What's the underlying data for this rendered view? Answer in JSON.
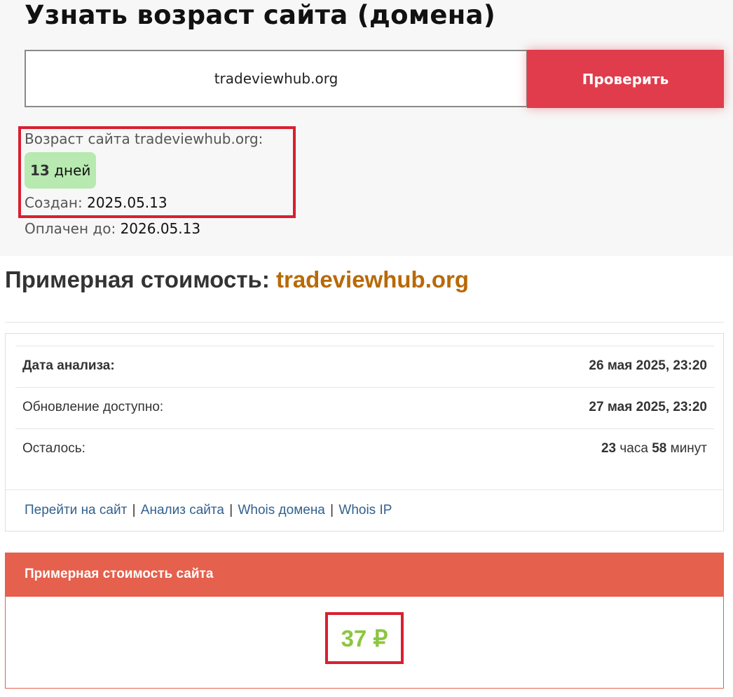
{
  "header": {
    "title": "Узнать возраст сайта (домена)"
  },
  "search": {
    "value": "tradeviewhub.org",
    "button_label": "Проверить"
  },
  "result": {
    "age_label": "Возраст сайта tradeviewhub.org:",
    "age_number": "13",
    "age_unit": "дней",
    "created_label": "Создан:",
    "created_value": "2025.05.13",
    "paid_label": "Оплачен до:",
    "paid_value": "2026.05.13"
  },
  "estimate": {
    "heading_prefix": "Примерная стоимость:",
    "heading_domain": "tradeviewhub.org",
    "rows": [
      {
        "label": "Дата анализа:",
        "value": "26 мая 2025, 23:20"
      },
      {
        "label": "Обновление доступно:",
        "value": "27 мая 2025, 23:20"
      },
      {
        "label": "Осталось:",
        "hours": "23",
        "hours_unit": "часа",
        "minutes": "58",
        "minutes_unit": "минут"
      }
    ],
    "links": [
      "Перейти на сайт",
      "Анализ сайта",
      "Whois домена",
      "Whois IP"
    ],
    "link_separator": "|",
    "cost_title": "Примерная стоимость сайта",
    "cost_value": "37 ₽"
  },
  "colors": {
    "accent_red": "#e03c4b",
    "highlight_border": "#d8202f",
    "badge_green": "#b7e9b0",
    "domain_orange": "#b86a06",
    "panel_header": "#e5604d",
    "cost_green": "#8cc63f",
    "link_blue": "#33608f"
  }
}
